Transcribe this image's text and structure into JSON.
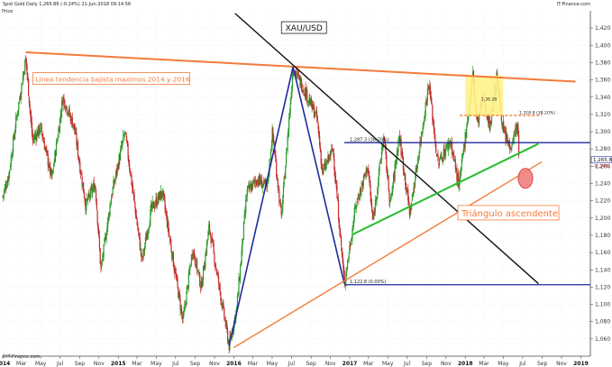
{
  "header": {
    "title": "Spot Gold  Daily  1,265.86 (-0.24%)  21-Jun-2018 09:14:56",
    "source": "IT-Finance.com",
    "y_axis_name": "Price",
    "footer": "©IT-Finance.com"
  },
  "chart_data": {
    "type": "line",
    "style": "candlestick",
    "instrument": "XAU/USD",
    "series": [
      {
        "name": "Spot Gold",
        "last": 1265.86,
        "change_pct": "-0.24%"
      }
    ],
    "ylim": [
      1040,
      1440
    ],
    "yticks": [
      "1,060",
      "1,080",
      "1,100",
      "1,120",
      "1,140",
      "1,160",
      "1,180",
      "1,200",
      "1,220",
      "1,240",
      "1,260",
      "1,280",
      "1,300",
      "1,320",
      "1,340",
      "1,360",
      "1,380",
      "1,400",
      "1,420"
    ],
    "xlim": [
      "2014-01-01",
      "2019-01-31"
    ],
    "xticks": [
      {
        "date": "2014-01-01",
        "label": "2014",
        "year": true
      },
      {
        "date": "2014-03-01",
        "label": "Mar"
      },
      {
        "date": "2014-05-01",
        "label": "May"
      },
      {
        "date": "2014-07-01",
        "label": "Jul"
      },
      {
        "date": "2014-09-01",
        "label": "Sep"
      },
      {
        "date": "2014-11-01",
        "label": "Nov"
      },
      {
        "date": "2015-01-01",
        "label": "2015",
        "year": true
      },
      {
        "date": "2015-03-01",
        "label": "Mar"
      },
      {
        "date": "2015-05-01",
        "label": "May"
      },
      {
        "date": "2015-07-01",
        "label": "Jul"
      },
      {
        "date": "2015-09-01",
        "label": "Sep"
      },
      {
        "date": "2015-11-01",
        "label": "Nov"
      },
      {
        "date": "2016-01-01",
        "label": "2016",
        "year": true
      },
      {
        "date": "2016-03-01",
        "label": "Mar"
      },
      {
        "date": "2016-05-01",
        "label": "May"
      },
      {
        "date": "2016-07-01",
        "label": "Jul"
      },
      {
        "date": "2016-09-01",
        "label": "Sep"
      },
      {
        "date": "2016-11-01",
        "label": "Nov"
      },
      {
        "date": "2017-01-01",
        "label": "2017",
        "year": true
      },
      {
        "date": "2017-03-01",
        "label": "Mar"
      },
      {
        "date": "2017-05-01",
        "label": "May"
      },
      {
        "date": "2017-07-01",
        "label": "Jul"
      },
      {
        "date": "2017-09-01",
        "label": "Sep"
      },
      {
        "date": "2017-11-01",
        "label": "Nov"
      },
      {
        "date": "2018-01-01",
        "label": "2018",
        "year": true
      },
      {
        "date": "2018-03-01",
        "label": "Mar"
      },
      {
        "date": "2018-05-01",
        "label": "May"
      },
      {
        "date": "2018-07-01",
        "label": "Jul"
      },
      {
        "date": "2018-09-01",
        "label": "Sep"
      },
      {
        "date": "2018-11-01",
        "label": "Nov"
      },
      {
        "date": "2019-01-01",
        "label": "2019",
        "year": true
      }
    ],
    "price_path": [
      [
        "2014-01-01",
        1225
      ],
      [
        "2014-01-20",
        1250
      ],
      [
        "2014-02-15",
        1320
      ],
      [
        "2014-03-15",
        1385
      ],
      [
        "2014-04-05",
        1290
      ],
      [
        "2014-05-01",
        1305
      ],
      [
        "2014-06-05",
        1245
      ],
      [
        "2014-07-10",
        1340
      ],
      [
        "2014-08-15",
        1305
      ],
      [
        "2014-09-20",
        1215
      ],
      [
        "2014-10-20",
        1240
      ],
      [
        "2014-11-07",
        1140
      ],
      [
        "2014-12-10",
        1225
      ],
      [
        "2015-01-22",
        1300
      ],
      [
        "2015-03-17",
        1150
      ],
      [
        "2015-04-15",
        1210
      ],
      [
        "2015-05-20",
        1230
      ],
      [
        "2015-07-24",
        1080
      ],
      [
        "2015-08-24",
        1165
      ],
      [
        "2015-09-20",
        1120
      ],
      [
        "2015-10-15",
        1190
      ],
      [
        "2015-12-17",
        1052
      ],
      [
        "2016-01-10",
        1095
      ],
      [
        "2016-02-11",
        1230
      ],
      [
        "2016-03-15",
        1245
      ],
      [
        "2016-04-15",
        1235
      ],
      [
        "2016-05-02",
        1300
      ],
      [
        "2016-05-30",
        1200
      ],
      [
        "2016-07-06",
        1375
      ],
      [
        "2016-08-15",
        1345
      ],
      [
        "2016-09-20",
        1315
      ],
      [
        "2016-10-07",
        1252
      ],
      [
        "2016-11-09",
        1280
      ],
      [
        "2016-12-15",
        1124
      ],
      [
        "2017-01-20",
        1215
      ],
      [
        "2017-02-27",
        1260
      ],
      [
        "2017-03-15",
        1195
      ],
      [
        "2017-04-18",
        1295
      ],
      [
        "2017-05-09",
        1215
      ],
      [
        "2017-06-06",
        1296
      ],
      [
        "2017-07-10",
        1205
      ],
      [
        "2017-09-08",
        1357
      ],
      [
        "2017-10-06",
        1262
      ],
      [
        "2017-11-15",
        1290
      ],
      [
        "2017-12-12",
        1236
      ],
      [
        "2018-01-25",
        1366
      ],
      [
        "2018-02-08",
        1307
      ],
      [
        "2018-02-25",
        1340
      ],
      [
        "2018-03-20",
        1307
      ],
      [
        "2018-04-11",
        1365
      ],
      [
        "2018-05-01",
        1300
      ],
      [
        "2018-05-21",
        1282
      ],
      [
        "2018-06-14",
        1308
      ],
      [
        "2018-06-21",
        1265.86
      ]
    ],
    "annotations": {
      "xau_label": "XAU/USD",
      "downtrend_label": "Linea tendencia bajista maximos 2014 y 2016",
      "triangle_label": "Triángulo ascendente",
      "fib_382": "1,287.3 (38.20%)",
      "fib_0": "1,122.8 (0.00%)",
      "fib_618": "1,318.8 (38.20%)",
      "top_label": "1,36.28"
    },
    "lines": {
      "resistance_2014_2016": {
        "from": [
          "2014-03-15",
          1392
        ],
        "to": [
          "2018-12-15",
          1358
        ],
        "color": "#f47a3a"
      },
      "blue_up": {
        "from": [
          "2015-12-17",
          1052
        ],
        "to": [
          "2016-07-06",
          1375
        ],
        "color": "#1f2a9c"
      },
      "blue_down": {
        "from": [
          "2016-07-06",
          1375
        ],
        "to": [
          "2016-12-15",
          1124
        ],
        "color": "#1f2a9c"
      },
      "black_down": {
        "from": [
          "2016-01-05",
          1437
        ],
        "to": [
          "2018-08-20",
          1124
        ],
        "color": "#111111"
      },
      "orange_up": {
        "from": [
          "2016-01-01",
          1050
        ],
        "to": [
          "2018-08-30",
          1265
        ],
        "color": "#f47a3a"
      },
      "green_up": {
        "from": [
          "2017-01-10",
          1181
        ],
        "to": [
          "2018-08-20",
          1286
        ],
        "color": "#22c02a"
      },
      "fib_382_line": {
        "from": [
          "2016-12-15",
          1287.3
        ],
        "to": [
          "2019-01-31",
          1287.3
        ],
        "color": "#1f2a9c"
      },
      "fib_0_line": {
        "from": [
          "2016-12-15",
          1122.8
        ],
        "to": [
          "2019-01-31",
          1122.8
        ],
        "color": "#1f2a9c"
      },
      "fib_618_dashed": {
        "from": [
          "2017-12-15",
          1318.8
        ],
        "to": [
          "2018-08-30",
          1318.8
        ],
        "color": "#f47a3a"
      }
    },
    "highlight_box": {
      "x": [
        "2018-01-01",
        "2018-05-01"
      ],
      "y": [
        1318,
        1365
      ],
      "color": "#fff38a"
    },
    "ellipse": {
      "date": "2018-07-10",
      "y": 1246,
      "color": "#f08080"
    },
    "grid": true,
    "legend": "none"
  },
  "colors": {
    "up": "#2a9c2a",
    "down": "#c42a2a",
    "orange": "#f47a3a",
    "blue": "#1f2a9c",
    "green": "#22c02a",
    "axis": "#333333"
  }
}
